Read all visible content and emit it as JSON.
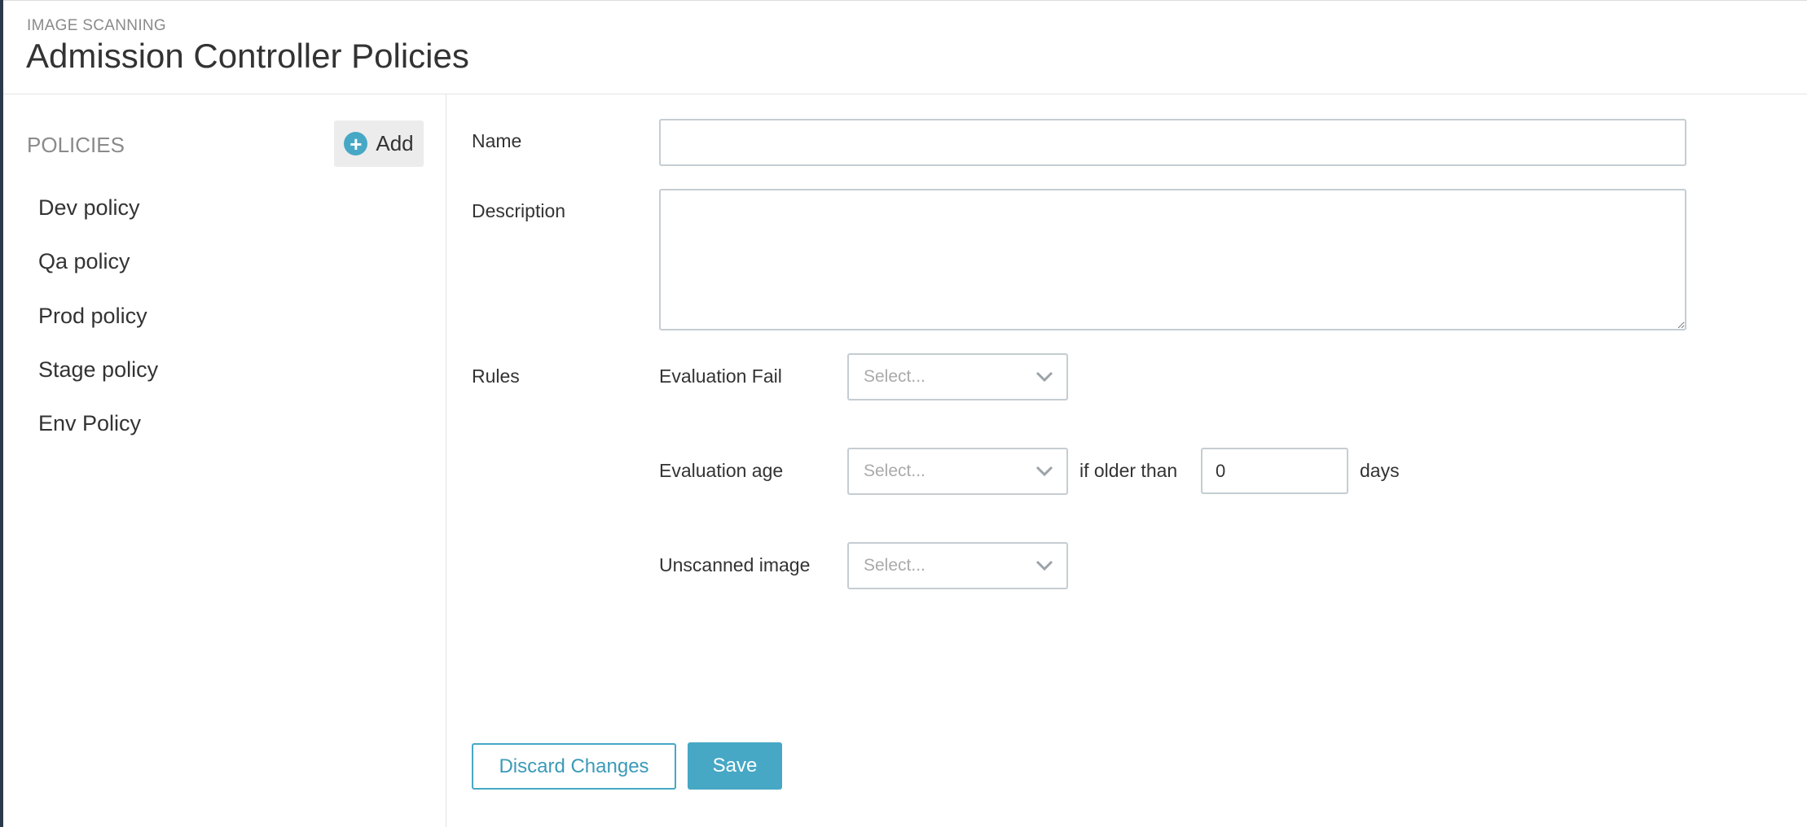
{
  "header": {
    "breadcrumb": "IMAGE SCANNING",
    "title": "Admission Controller Policies"
  },
  "sidebar": {
    "heading": "POLICIES",
    "add_label": "Add",
    "policies": [
      {
        "label": "Dev policy"
      },
      {
        "label": "Qa policy"
      },
      {
        "label": "Prod policy"
      },
      {
        "label": "Stage policy"
      },
      {
        "label": "Env Policy"
      }
    ]
  },
  "form": {
    "name_label": "Name",
    "name_value": "",
    "description_label": "Description",
    "description_value": "",
    "rules_label": "Rules",
    "rules": {
      "evaluation_fail_label": "Evaluation Fail",
      "evaluation_fail_placeholder": "Select...",
      "evaluation_age_label": "Evaluation age",
      "evaluation_age_placeholder": "Select...",
      "older_than_text": "if older than",
      "days_value": "0",
      "days_text": "days",
      "unscanned_label": "Unscanned image",
      "unscanned_placeholder": "Select..."
    }
  },
  "actions": {
    "discard_label": "Discard Changes",
    "save_label": "Save"
  },
  "colors": {
    "accent": "#46a8c5",
    "sidebar_strip": "#2b3a4a"
  },
  "icons": {
    "add": "plus-circle-icon",
    "select": "chevron-down-icon"
  }
}
